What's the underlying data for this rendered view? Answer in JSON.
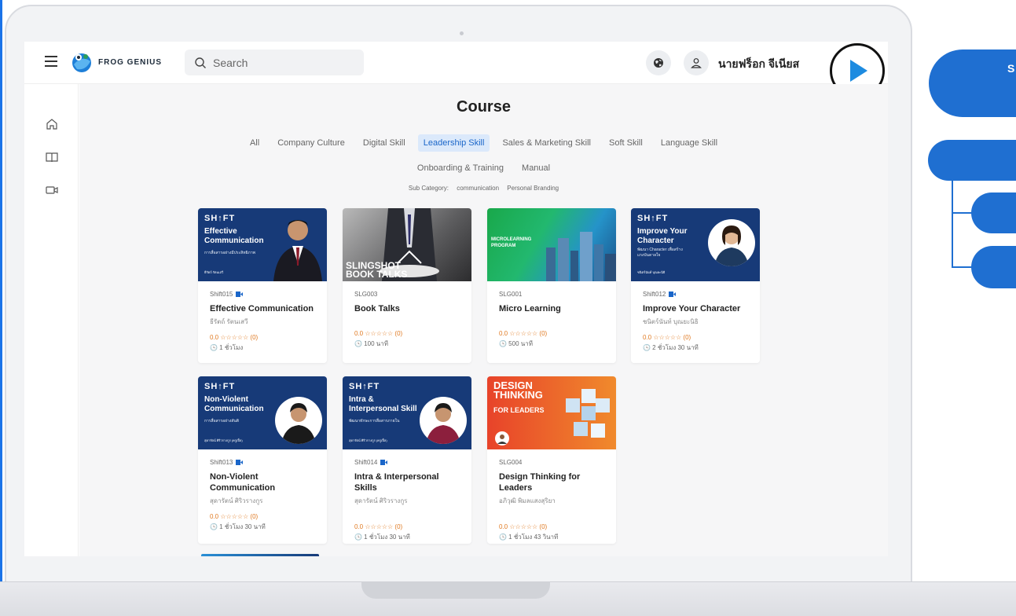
{
  "header": {
    "brand": "FROG GENIUS",
    "search_placeholder": "Search",
    "user_name": "นายฟร็อก จีเนียส"
  },
  "sidebar": {
    "icons": [
      "home-icon",
      "book-icon",
      "video-icon"
    ]
  },
  "page": {
    "title": "Course",
    "tabs_row1": [
      "All",
      "Company Culture",
      "Digital Skill",
      "Leadership Skill",
      "Sales & Marketing Skill",
      "Soft Skill",
      "Language Skill"
    ],
    "tabs_row2": [
      "Onboarding & Training",
      "Manual"
    ],
    "active_tab": "Leadership Skill",
    "subcategory_label": "Sub Category:",
    "subcategories": [
      "communication",
      "Personal Branding"
    ]
  },
  "thumbnails": {
    "shift_brand": "SH↑FT",
    "slingshot": "SLINGSHOT",
    "book_talks": "BOOK TALKS",
    "micro_l1": "MICROLEARNING",
    "micro_l2": "PROGRAM",
    "design_l1": "DESIGN",
    "design_l2": "THINKING",
    "design_l3": "FOR LEADERS",
    "effective": {
      "title_l1": "Effective",
      "title_l2": "Communication",
      "sub": "การสื่อสารอย่างมีประสิทธิภาพ",
      "person": "ธีรัตถ์ รัตนเสวี"
    },
    "character": {
      "title_l1": "Improve Your",
      "title_l2": "Character",
      "sub": "พัฒนา Character เพื่อสร้างแรงบันดาลใจ",
      "person": "ชนิตร์นันท์ บุณยะนิธิ"
    },
    "nonviolent": {
      "title_l1": "Non-Violent",
      "title_l2": "Communication",
      "sub": "การสื่อสารอย่างสันติ",
      "person": "สุดารัตน์ ศิริวรางกูร (ครูเปิ้ล)"
    },
    "intra": {
      "title_l1": "Intra &",
      "title_l2": "Interpersonal Skill",
      "sub": "พัฒนาทักษะการสื่อสารภายใน",
      "person": "สุดารัตน์ ศิริวรางกูร (ครูเปิ้ล)"
    }
  },
  "courses": [
    {
      "code": "Shift015",
      "video": true,
      "title": "Effective Communication",
      "author": "ธีรัตถ์ รัตนเสวี",
      "rating": "0.0 ☆☆☆☆☆ (0)",
      "duration": "🕓 1 ชั่วโมง"
    },
    {
      "code": "SLG003",
      "video": false,
      "title": "Book Talks",
      "author": "",
      "rating": "0.0 ☆☆☆☆☆ (0)",
      "duration": "🕓 100 นาที"
    },
    {
      "code": "SLG001",
      "video": false,
      "title": "Micro Learning",
      "author": "",
      "rating": "0.0 ☆☆☆☆☆ (0)",
      "duration": "🕓 500 นาที"
    },
    {
      "code": "Shift012",
      "video": true,
      "title": "Improve Your Character",
      "author": "ชนิตร์นันท์ บุณยะนิธิ",
      "rating": "0.0 ☆☆☆☆☆ (0)",
      "duration": "🕓 2 ชั่วโมง 30 นาที"
    },
    {
      "code": "Shift013",
      "video": true,
      "title": "Non-Violent Communication",
      "author": "สุดารัตน์ ศิริวรางกูร",
      "rating": "0.0 ☆☆☆☆☆ (0)",
      "duration": "🕓 1 ชั่วโมง 30 นาที"
    },
    {
      "code": "Shift014",
      "video": true,
      "title": "Intra & Interpersonal Skills",
      "author": "สุดารัตน์ ศิริวรางกูร",
      "rating": "0.0 ☆☆☆☆☆ (0)",
      "duration": "🕓 1 ชั่วโมง 30 นาที"
    },
    {
      "code": "SLG004",
      "video": false,
      "title": "Design Thinking for Leaders",
      "author": "อภิวุฒิ พิมลแสงสุริยา",
      "rating": "0.0 ☆☆☆☆☆ (0)",
      "duration": "🕓 1 ชั่วโมง 43 วินาที"
    }
  ],
  "overlay": {
    "pill_label": "S"
  },
  "colors": {
    "accent": "#1a66c9",
    "active_tab_bg": "#dbe9fb",
    "rating": "#e07a22",
    "overlay_blue": "#1f6fd1",
    "shift_navy": "#173a78"
  }
}
